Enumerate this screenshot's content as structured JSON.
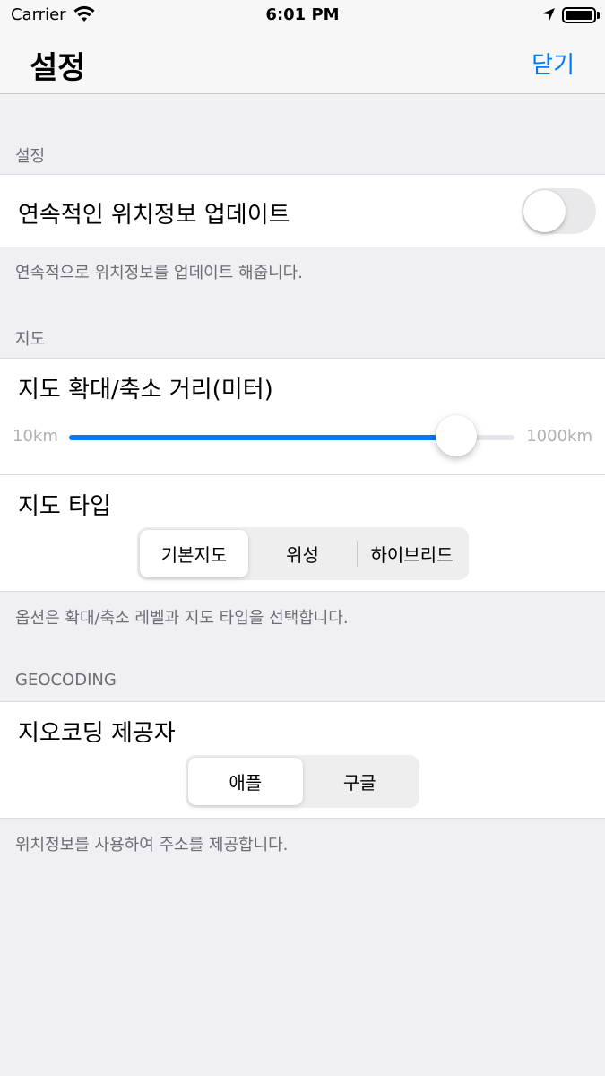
{
  "status_bar": {
    "carrier": "Carrier",
    "time": "6:01 PM"
  },
  "nav": {
    "title": "설정",
    "close_label": "닫기"
  },
  "section_settings": {
    "header": "설정",
    "continuous_update_label": "연속적인 위치정보 업데이트",
    "continuous_update_on": false,
    "footer": "연속적으로 위치정보를 업데이트 해줍니다."
  },
  "section_map": {
    "header": "지도",
    "zoom_label": "지도 확대/축소 거리(미터)",
    "zoom_min": "10km",
    "zoom_max": "1000km",
    "zoom_value_fraction": 0.87,
    "map_type_label": "지도 타입",
    "map_types": [
      "기본지도",
      "위성",
      "하이브리드"
    ],
    "map_type_selected": 0,
    "footer": "옵션은 확대/축소 레벨과 지도 타입을 선택합니다."
  },
  "section_geocoding": {
    "header": "GEOCODING",
    "provider_label": "지오코딩 제공자",
    "providers": [
      "애플",
      "구글"
    ],
    "provider_selected": 0,
    "footer": "위치정보를 사용하여 주소를 제공합니다."
  },
  "colors": {
    "accent": "#007aff",
    "background": "#efeff4",
    "secondary_text": "#6d6d72"
  }
}
